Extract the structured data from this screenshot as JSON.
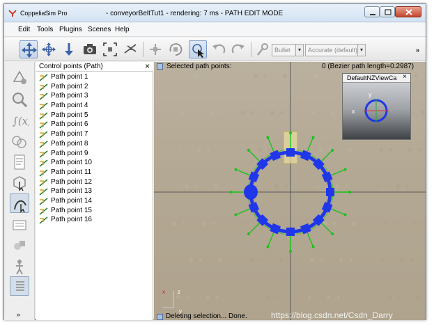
{
  "window": {
    "app_name": "CoppeliaSim Pro",
    "title": "- conveyorBeltTut1 - rendering: 7 ms - PATH EDIT MODE"
  },
  "menu": [
    "Edit",
    "Tools",
    "Plugins",
    "Scenes",
    "Help"
  ],
  "toolbar": {
    "buttons": [
      {
        "icon": "move-cross-icon",
        "active": true
      },
      {
        "icon": "rotate-cross-icon",
        "active": false
      },
      {
        "icon": "zoom-arrows-icon",
        "active": false
      },
      {
        "icon": "camera-icon",
        "active": false
      },
      {
        "icon": "fit-view-icon",
        "active": false
      },
      {
        "icon": "fly-icon",
        "active": false
      },
      {
        "icon": "object-shift-icon",
        "active": false
      },
      {
        "icon": "object-rotate-icon",
        "active": false
      },
      {
        "icon": "click-select-icon",
        "active": true
      },
      {
        "icon": "undo-icon",
        "active": false
      },
      {
        "icon": "redo-icon",
        "active": false
      },
      {
        "icon": "dynamics-icon",
        "active": false
      }
    ],
    "engine_select": "Bullet",
    "accuracy_select": "Accurate (default)",
    "more": "»"
  },
  "sidebar": {
    "buttons": [
      "vertex-edit-icon",
      "magnifier-icon",
      "function-icon",
      "path-planning-icon",
      "script-page-icon",
      "cube-select-icon",
      "path-edit-icon",
      "panel-icon",
      "multi-shape-icon",
      "person-icon",
      "list-page-icon"
    ],
    "more": "»"
  },
  "hierarchy": {
    "title": "Control points (Path)",
    "close": "×",
    "items": [
      "Path point 1",
      "Path point 2",
      "Path point 3",
      "Path point 4",
      "Path point 5",
      "Path point 6",
      "Path point 7",
      "Path point 8",
      "Path point 9",
      "Path point 10",
      "Path point 11",
      "Path point 12",
      "Path point 13",
      "Path point 14",
      "Path point 15",
      "Path point 16"
    ]
  },
  "scene": {
    "selection_label": "Selected path points:",
    "selection_info": "0 (Bezier path length=0.2987)",
    "view_title": "DefaultNZViewCa",
    "view_close": "×",
    "axis_x": "x",
    "axis_y": "y",
    "axis_z": "z",
    "status": "Deleting selection... Done.",
    "watermark": "https://blog.csdn.net/Csdn_Darry"
  },
  "colors": {
    "path_point": "#1f37e8",
    "path_curve": "#1f37e8",
    "normal_arrow": "#18c21a",
    "selection_box": "#f5e7a3",
    "guide_lines": "#595959"
  }
}
